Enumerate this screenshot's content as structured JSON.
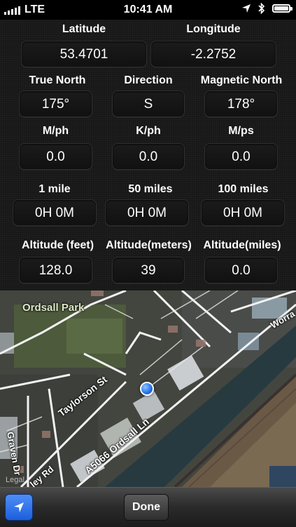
{
  "status_bar": {
    "carrier": "LTE",
    "time": "10:41 AM",
    "signal_bars": 5,
    "battery_level": 1.0,
    "icons": [
      "location-arrow-icon",
      "bluetooth-icon",
      "battery-icon"
    ]
  },
  "location": {
    "latitude_label": "Latitude",
    "latitude_value": "53.4701",
    "longitude_label": "Longitude",
    "longitude_value": "-2.2752"
  },
  "heading": {
    "true_north_label": "True North",
    "true_north_value": "175°",
    "direction_label": "Direction",
    "direction_value": "S",
    "magnetic_north_label": "Magnetic North",
    "magnetic_north_value": "178°"
  },
  "speed": {
    "mph_label": "M/ph",
    "mph_value": "0.0",
    "kph_label": "K/ph",
    "kph_value": "0.0",
    "mps_label": "M/ps",
    "mps_value": "0.0"
  },
  "eta": {
    "one_mile_label": "1 mile",
    "one_mile_value": "0H 0M",
    "fifty_miles_label": "50 miles",
    "fifty_miles_value": "0H 0M",
    "hundred_miles_label": "100 miles",
    "hundred_miles_value": "0H 0M"
  },
  "altitude": {
    "feet_label": "Altitude (feet)",
    "feet_value": "128.0",
    "meters_label": "Altitude(meters)",
    "meters_value": "39",
    "miles_label": "Altitude(miles)",
    "miles_value": "0.0"
  },
  "map": {
    "labels": {
      "park": "Ordsall Park",
      "taylorson": "Taylorson St",
      "ordsall_lane": "A5066 Ordsall Ln",
      "graven": "Graven Dr",
      "ley_rd": "ley Rd",
      "worr": "Worra",
      "legal": "Legal"
    }
  },
  "toolbar": {
    "done_label": "Done",
    "accent_color": "#2a6fe6"
  }
}
